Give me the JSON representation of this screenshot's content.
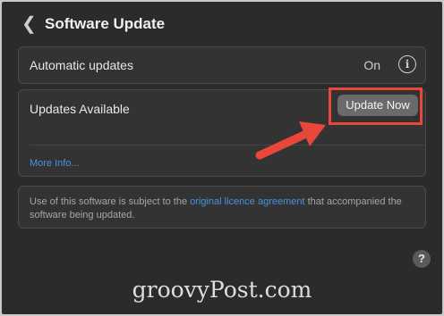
{
  "header": {
    "back_glyph": "❮",
    "title": "Software Update"
  },
  "automatic": {
    "label": "Automatic updates",
    "status": "On",
    "info_glyph": "i"
  },
  "updates": {
    "label": "Updates Available",
    "button_label": "Update Now",
    "more_info": "More Info..."
  },
  "notice": {
    "text_before": "Use of this software is subject to the ",
    "link": "original licence agreement",
    "text_after": " that accompanied the software being updated."
  },
  "help_glyph": "?",
  "watermark": "groovyPost.com",
  "colors": {
    "accent": "#e8473a",
    "link": "#4a90e2",
    "background": "#2b2b2b"
  }
}
